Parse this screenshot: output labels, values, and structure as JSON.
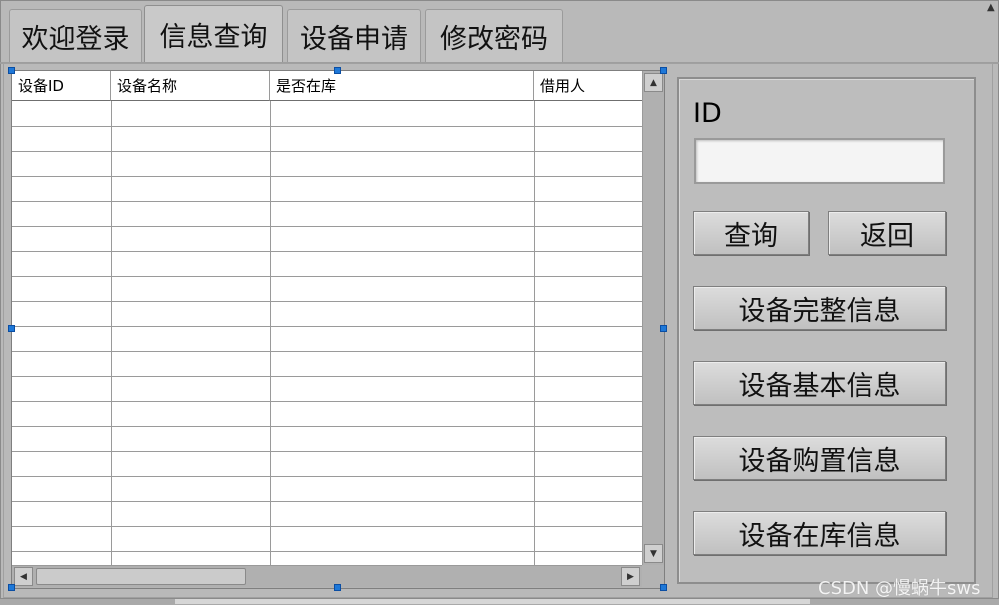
{
  "tabs": [
    {
      "label": "欢迎登录"
    },
    {
      "label": "信息查询",
      "active": true
    },
    {
      "label": "设备申请"
    },
    {
      "label": "修改密码"
    }
  ],
  "table": {
    "columns": [
      "设备ID",
      "设备名称",
      "是否在库",
      "借用人"
    ],
    "rows": []
  },
  "form": {
    "id_label": "ID",
    "id_value": ""
  },
  "buttons": {
    "query": "查询",
    "back": "返回",
    "full_info": "设备完整信息",
    "basic_info": "设备基本信息",
    "purchase_info": "设备购置信息",
    "stock_info": "设备在库信息"
  },
  "watermark": "CSDN @慢蜗牛sws",
  "icons": {
    "scroll_up": "arrow-up-icon",
    "scroll_down": "arrow-down-icon",
    "scroll_left": "arrow-left-icon",
    "scroll_right": "arrow-right-icon"
  },
  "colors": {
    "background": "#b9b9b9",
    "selection_handle": "#1e78d8"
  }
}
